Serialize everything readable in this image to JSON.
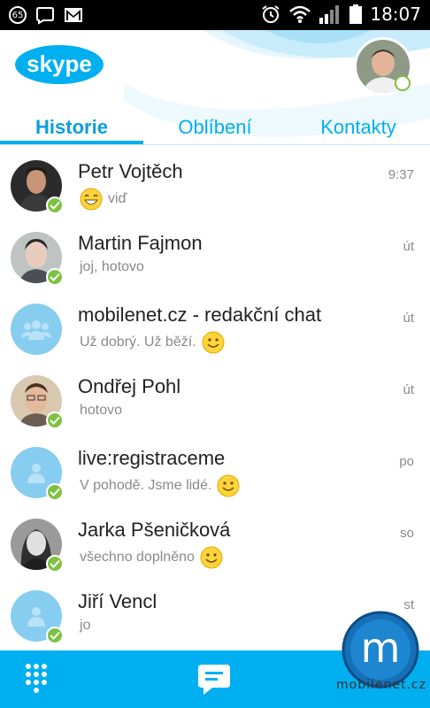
{
  "status_bar": {
    "notification_count": "65",
    "time": "18:07",
    "icons": [
      "badge-icon",
      "chat-bubble-icon",
      "gmail-icon",
      "alarm-icon",
      "wifi-icon",
      "signal-icon",
      "battery-icon"
    ]
  },
  "header": {
    "logo": "skype",
    "colors": {
      "accent": "#00aff0",
      "online": "#7dc242"
    }
  },
  "tabs": [
    {
      "label": "Historie",
      "active": true
    },
    {
      "label": "Oblíbení",
      "active": false
    },
    {
      "label": "Kontakty",
      "active": false
    }
  ],
  "conversations": [
    {
      "name": "Petr Vojtěch",
      "preview": "viď",
      "emoji_before": true,
      "emoji": "grin",
      "time": "9:37",
      "online": true,
      "avatar": "photo"
    },
    {
      "name": "Martin  Fajmon",
      "preview": "joj, hotovo",
      "time": "út",
      "online": true,
      "avatar": "photo"
    },
    {
      "name": "mobilenet.cz - redakční chat",
      "preview": "Už dobrý. Už běží.",
      "emoji_after": true,
      "emoji": "smile",
      "time": "út",
      "online": false,
      "avatar": "group"
    },
    {
      "name": "Ondřej Pohl",
      "preview": "hotovo",
      "time": "út",
      "online": true,
      "avatar": "photo"
    },
    {
      "name": "live:registraceme",
      "preview": "V pohodě. Jsme lidé.",
      "emoji_after": true,
      "emoji": "smile",
      "time": "po",
      "online": true,
      "avatar": "person"
    },
    {
      "name": "Jarka Pšeničková",
      "preview": "všechno doplněno",
      "emoji_after": true,
      "emoji": "smile",
      "time": "so",
      "online": true,
      "avatar": "photo"
    },
    {
      "name": "Jiří Vencl",
      "preview": "jo",
      "time": "st",
      "online": true,
      "avatar": "person"
    }
  ],
  "bottom_bar": {
    "icons": [
      "dialpad-icon",
      "chat-icon"
    ]
  },
  "watermark": {
    "text": "mobilenet.cz"
  }
}
